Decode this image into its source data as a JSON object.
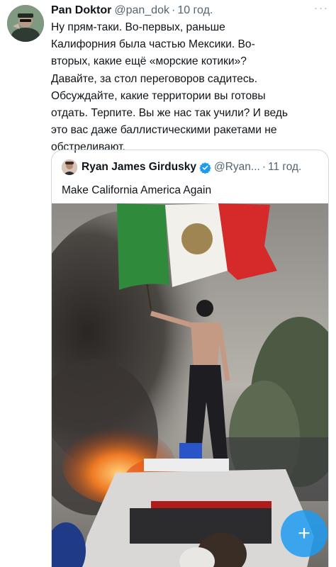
{
  "tweet": {
    "author_name": "Pan Doktor",
    "author_handle": "@pan_dok",
    "separator": "·",
    "time": "10 год.",
    "more_icon": "more-icon",
    "text": "Ну прям-таки. Во-первых, раньше\nКалифорния была частью Мексики. Во-\nвторых, какие ещё «морские котики»?\nДавайте, за стол переговоров садитесь.\nОбсуждайте, какие территории вы готовы\nотдать. Терпите. Вы же нас так учили? И ведь\nэто вас даже баллистическими ракетами не\nобстреливают."
  },
  "quote": {
    "author_name": "Ryan James Girdusky",
    "verified_icon": "verified-badge-icon",
    "author_handle": "@Ryan...",
    "separator": "·",
    "time": "11 год.",
    "text": "Make California America Again",
    "media": "protester-on-car-with-flag-image"
  },
  "fab": {
    "icon": "plus-icon",
    "label": "+"
  },
  "colors": {
    "accent": "#1d9bf0",
    "text_primary": "#0f1419",
    "text_secondary": "#536471",
    "border": "#cfd9de"
  }
}
